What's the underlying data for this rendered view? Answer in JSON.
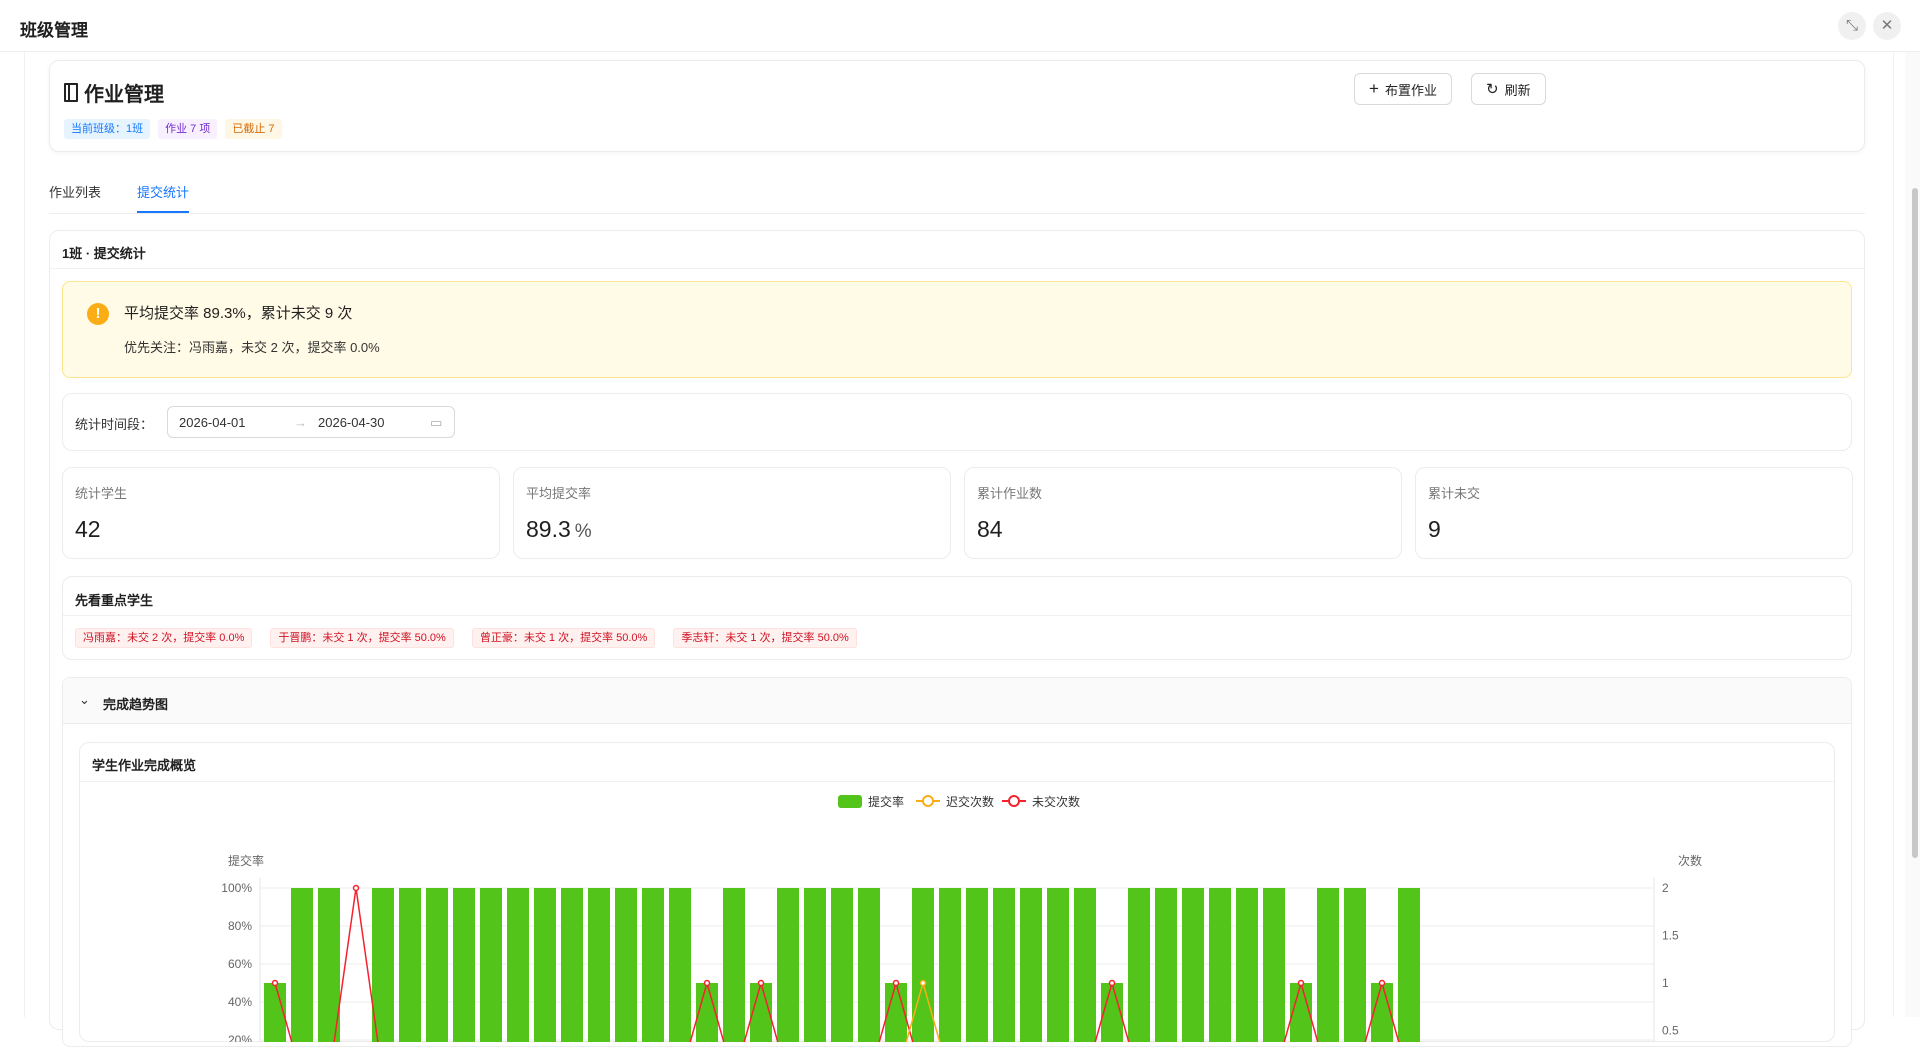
{
  "window": {
    "title": "班级管理"
  },
  "header": {
    "title": "作业管理",
    "tags": [
      "当前班级：1班",
      "作业 7 项",
      "已截止 7"
    ],
    "assign_button": "布置作业",
    "refresh_button": "刷新"
  },
  "tabs": [
    {
      "label": "作业列表",
      "active": false
    },
    {
      "label": "提交统计",
      "active": true
    }
  ],
  "stats": {
    "title": "1班 · 提交统计",
    "alert": {
      "main": "平均提交率 89.3%，累计未交 9 次",
      "sub": "优先关注：冯雨嘉，未交 2 次，提交率 0.0%"
    },
    "range": {
      "label": "统计时间段：",
      "start": "2026-04-01",
      "end": "2026-04-30"
    },
    "metrics": [
      {
        "label": "统计学生",
        "value": "42",
        "unit": ""
      },
      {
        "label": "平均提交率",
        "value": "89.3",
        "unit": "%"
      },
      {
        "label": "累计作业数",
        "value": "84",
        "unit": ""
      },
      {
        "label": "累计未交",
        "value": "9",
        "unit": ""
      }
    ],
    "focus": {
      "title": "先看重点学生",
      "students": [
        "冯雨嘉：未交 2 次，提交率 0.0%",
        "于晋鹏：未交 1 次，提交率 50.0%",
        "曾正豪：未交 1 次，提交率 50.0%",
        "季志轩：未交 1 次，提交率 50.0%"
      ]
    },
    "trend": {
      "title": "完成趋势图"
    }
  },
  "chart_data": {
    "type": "bar",
    "title": "学生作业完成概览",
    "legend": [
      "提交率",
      "迟交次数",
      "未交次数"
    ],
    "legend_position": "top-center",
    "ylabel_left": "提交率",
    "ylabel_right": "次数",
    "yticks_left": [
      "100%",
      "80%",
      "60%",
      "40%",
      "20%"
    ],
    "yticks_right": [
      "2",
      "1.5",
      "1",
      "0.5"
    ],
    "ylim_left": [
      0,
      100
    ],
    "ylim_right": [
      0,
      2
    ],
    "series": [
      {
        "name": "提交率",
        "type": "bar",
        "values": [
          50,
          100,
          100,
          0,
          100,
          100,
          100,
          100,
          100,
          100,
          100,
          100,
          100,
          100,
          100,
          100,
          50,
          100,
          50,
          100,
          100,
          100,
          100,
          50,
          100,
          100,
          100,
          100,
          100,
          100,
          100,
          50,
          100,
          100,
          100,
          100,
          100,
          100,
          50,
          100,
          100,
          50,
          100
        ]
      },
      {
        "name": "迟交次数",
        "type": "line",
        "values": [
          0,
          0,
          0,
          0,
          0,
          0,
          0,
          0,
          0,
          0,
          0,
          0,
          0,
          0,
          0,
          0,
          0,
          0,
          0,
          0,
          0,
          0,
          0,
          0,
          1,
          0,
          0,
          0,
          0,
          0,
          0,
          0,
          0,
          0,
          0,
          0,
          0,
          0,
          0,
          0,
          0,
          0,
          0
        ]
      },
      {
        "name": "未交次数",
        "type": "line",
        "values": [
          1,
          0,
          0,
          2,
          0,
          0,
          0,
          0,
          0,
          0,
          0,
          0,
          0,
          0,
          0,
          0,
          1,
          0,
          1,
          0,
          0,
          0,
          0,
          1,
          0,
          0,
          0,
          0,
          0,
          0,
          0,
          1,
          0,
          0,
          0,
          0,
          0,
          0,
          1,
          0,
          0,
          1,
          0
        ]
      }
    ],
    "colors": {
      "bar": "#52c41a",
      "late": "#faad14",
      "missing": "#f5222d"
    }
  }
}
